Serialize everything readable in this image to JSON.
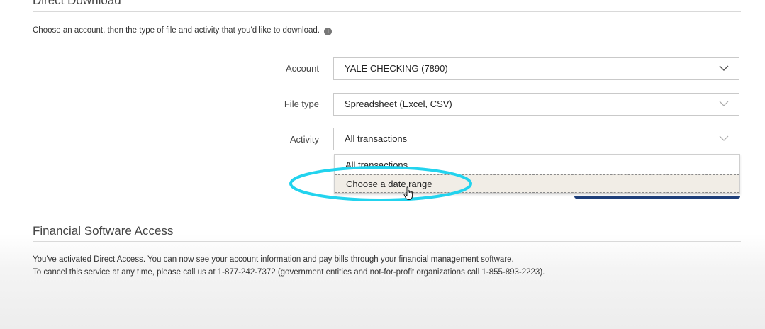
{
  "direct_download": {
    "title": "Direct Download",
    "intro": "Choose an account, then the type of file and activity that you'd like to download.",
    "account": {
      "label": "Account",
      "value": "YALE CHECKING (7890)"
    },
    "file_type": {
      "label": "File type",
      "value": "Spreadsheet (Excel, CSV)"
    },
    "activity": {
      "label": "Activity",
      "value": "All transactions",
      "options": [
        "All transactions",
        "Choose a date range"
      ]
    }
  },
  "financial_software": {
    "title": "Financial Software Access",
    "line1": "You've activated Direct Access. You can now see your account information and pay bills through your financial management software.",
    "line2": "To cancel this service at any time, please call us at 1-877-242-7372 (government entities and not-for-profit organizations call 1-855-893-2223)."
  },
  "colors": {
    "highlight_ellipse": "#22d3ee",
    "button_navy": "#1e3f7a"
  },
  "icons": {
    "info": "info-icon",
    "chevron": "chevron-down-icon",
    "cursor": "hand-pointer-cursor-icon"
  }
}
